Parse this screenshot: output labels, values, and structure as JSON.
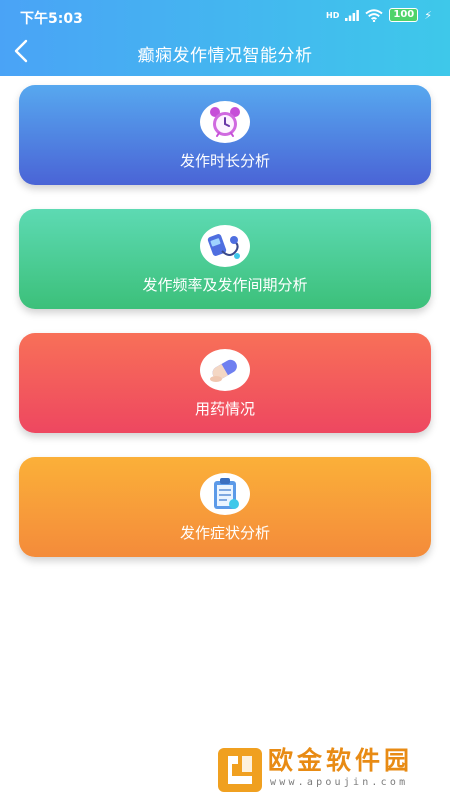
{
  "status_bar": {
    "time": "下午5:03",
    "signal_label": "HD",
    "battery": "100"
  },
  "header": {
    "title": "癫痫发作情况智能分析",
    "back_icon": "chevron-left-icon",
    "bg_colors": [
      "#4aa3f6",
      "#3ec8ea"
    ]
  },
  "cards": [
    {
      "label": "发作时长分析",
      "icon": "alarm-clock-icon",
      "colors": [
        "#57a8ef",
        "#4a64d6"
      ]
    },
    {
      "label": "发作频率及发作间期分析",
      "icon": "blood-pressure-icon",
      "colors": [
        "#5ddab3",
        "#3cc07a"
      ]
    },
    {
      "label": "用药情况",
      "icon": "pill-icon",
      "colors": [
        "#f87058",
        "#ee4760"
      ]
    },
    {
      "label": "发作症状分析",
      "icon": "clipboard-icon",
      "colors": [
        "#fbb039",
        "#f48b3a"
      ]
    }
  ],
  "watermark": {
    "text": "欧金软件园",
    "url": "www.apoujin.com",
    "color": "#e88b14"
  }
}
